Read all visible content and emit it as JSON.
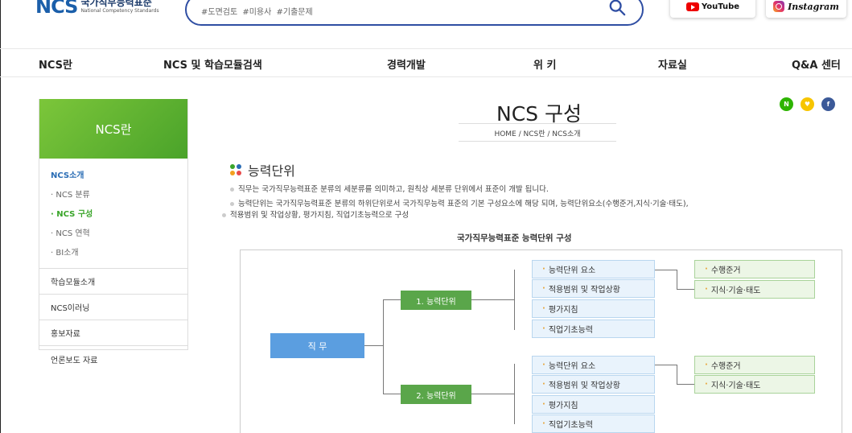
{
  "header": {
    "logo_mark": "NCS",
    "logo_kr": "국가직무능력표준",
    "logo_en": "National Competency Standards",
    "search_tags": "#도면검토  #미용사  #기출문제",
    "youtube_label": "YouTube",
    "instagram_label": "Instagram"
  },
  "nav": {
    "items": [
      "NCS란",
      "NCS 및 학습모듈검색",
      "경력개발",
      "위 키",
      "자료실",
      "Q&A 센터"
    ]
  },
  "sidebar": {
    "header": "NCS란",
    "sub_title": "NCS소개",
    "sub_items": [
      "· NCS 분류",
      "· NCS 구성",
      "· NCS 연혁",
      "· BI소개"
    ],
    "active_index": 1,
    "menus": [
      "학습모듈소개",
      "NCS이러닝",
      "홍보자료",
      "언론보도 자료"
    ]
  },
  "main": {
    "title": "NCS 구성",
    "breadcrumb": "HOME / NCS란 / NCS소개",
    "share": {
      "naver": "N",
      "kakao": "♥",
      "facebook": "f"
    },
    "section_title": "능력단위",
    "bullets": [
      "직무는 국가직무능력표준 분류의 세분류를 의미하고, 원칙상 세분류 단위에서 표준이 개발 됩니다.",
      "능력단위는 국가직무능력표준 분류의 하위단위로서 국가직무능력 표준의 기본 구성요소에 해당 되며, 능력단위요소(수행준거,지식·기술·태도),",
      "적용범위 및 작업상황, 평가지침, 직업기초능력으로 구성"
    ],
    "diagram_caption": "국가직무능력표준 능력단위 구성"
  },
  "diagram": {
    "root": "직 무",
    "units": [
      {
        "label": "1. 능력단위",
        "items": [
          "능력단위 요소",
          "적용범위 및 작업상황",
          "평가지침",
          "직업기초능력"
        ],
        "sub": [
          "수행준거",
          "지식·기술·태도"
        ]
      },
      {
        "label": "2. 능력단위",
        "items": [
          "능력단위 요소",
          "적용범위 및 작업상황",
          "평가지침",
          "직업기초능력"
        ],
        "sub": [
          "수행준거",
          "지식·기술·태도"
        ]
      }
    ]
  },
  "colors": {
    "brand_blue": "#2f4ea3",
    "green": "#5aa64a",
    "blue_box": "#5b9ee0",
    "active_green": "#3aa52a"
  }
}
